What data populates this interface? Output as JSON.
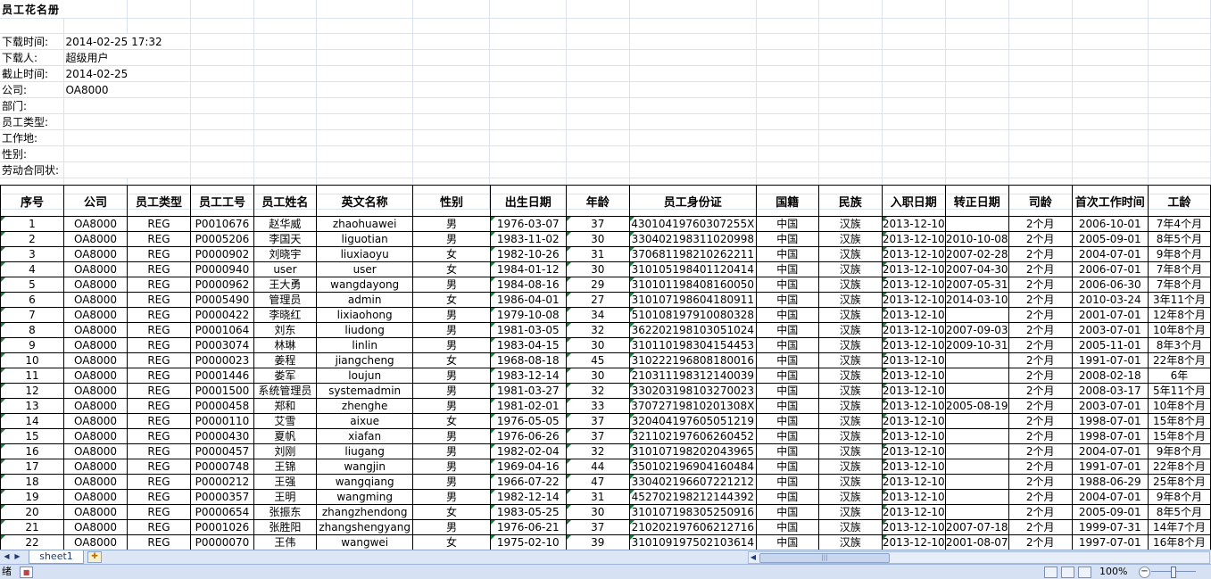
{
  "title": "员工花名册",
  "meta": [
    {
      "label": "下载时间:",
      "value": "2014-02-25 17:32"
    },
    {
      "label": "下载人:",
      "value": "超级用户"
    },
    {
      "label": "截止时间:",
      "value": "2014-02-25"
    },
    {
      "label": "公司:",
      "value": "OA8000"
    },
    {
      "label": "部门:",
      "value": ""
    },
    {
      "label": "员工类型:",
      "value": ""
    },
    {
      "label": "工作地:",
      "value": ""
    },
    {
      "label": "性别:",
      "value": ""
    },
    {
      "label": "劳动合同状:",
      "value": ""
    }
  ],
  "table": {
    "headers": [
      "序号",
      "公司",
      "员工类型",
      "员工工号",
      "员工姓名",
      "英文名称",
      "性别",
      "出生日期",
      "年龄",
      "员工身份证",
      "国籍",
      "民族",
      "入职日期",
      "转正日期",
      "司龄",
      "首次工作时间",
      "工龄"
    ],
    "rows": [
      [
        "1",
        "OA8000",
        "REG",
        "P0010676",
        "赵华威",
        "zhaohuawei",
        "男",
        "1976-03-07",
        "37",
        "43010419760307255X",
        "中国",
        "汉族",
        "2013-12-10",
        "",
        "2个月",
        "2006-10-01",
        "7年4个月"
      ],
      [
        "2",
        "OA8000",
        "REG",
        "P0005206",
        "李国天",
        "liguotian",
        "男",
        "1983-11-02",
        "30",
        "330402198311020998",
        "中国",
        "汉族",
        "2013-12-10",
        "2010-10-08",
        "2个月",
        "2005-09-01",
        "8年5个月"
      ],
      [
        "3",
        "OA8000",
        "REG",
        "P0000902",
        "刘晓宇",
        "liuxiaoyu",
        "女",
        "1982-10-26",
        "31",
        "370681198210262211",
        "中国",
        "汉族",
        "2013-12-10",
        "2007-02-28",
        "2个月",
        "2004-07-01",
        "9年8个月"
      ],
      [
        "4",
        "OA8000",
        "REG",
        "P0000940",
        "user",
        "user",
        "女",
        "1984-01-12",
        "30",
        "310105198401120414",
        "中国",
        "汉族",
        "2013-12-10",
        "2007-04-30",
        "2个月",
        "2006-07-01",
        "7年8个月"
      ],
      [
        "5",
        "OA8000",
        "REG",
        "P0000962",
        "王大勇",
        "wangdayong",
        "男",
        "1984-08-16",
        "29",
        "310101198408160050",
        "中国",
        "汉族",
        "2013-12-10",
        "2007-05-31",
        "2个月",
        "2006-06-30",
        "7年8个月"
      ],
      [
        "6",
        "OA8000",
        "REG",
        "P0005490",
        "管理员",
        "admin",
        "女",
        "1986-04-01",
        "27",
        "310107198604180911",
        "中国",
        "汉族",
        "2013-12-10",
        "2014-03-10",
        "2个月",
        "2010-03-24",
        "3年11个月"
      ],
      [
        "7",
        "OA8000",
        "REG",
        "P0000422",
        "李晓红",
        "lixiaohong",
        "男",
        "1979-10-08",
        "34",
        "510108197910080328",
        "中国",
        "汉族",
        "2013-12-10",
        "",
        "2个月",
        "2001-07-01",
        "12年8个月"
      ],
      [
        "8",
        "OA8000",
        "REG",
        "P0001064",
        "刘东",
        "liudong",
        "男",
        "1981-03-05",
        "32",
        "362202198103051024",
        "中国",
        "汉族",
        "2013-12-10",
        "2007-09-03",
        "2个月",
        "2003-07-01",
        "10年8个月"
      ],
      [
        "9",
        "OA8000",
        "REG",
        "P0003074",
        "林琳",
        "linlin",
        "男",
        "1983-04-15",
        "30",
        "310110198304154453",
        "中国",
        "汉族",
        "2013-12-10",
        "2009-10-31",
        "2个月",
        "2005-11-01",
        "8年3个月"
      ],
      [
        "10",
        "OA8000",
        "REG",
        "P0000023",
        "姜程",
        "jiangcheng",
        "女",
        "1968-08-18",
        "45",
        "310222196808180016",
        "中国",
        "汉族",
        "2013-12-10",
        "",
        "2个月",
        "1991-07-01",
        "22年8个月"
      ],
      [
        "11",
        "OA8000",
        "REG",
        "P0001446",
        "娄军",
        "loujun",
        "男",
        "1983-12-14",
        "30",
        "210311198312140039",
        "中国",
        "汉族",
        "2013-12-10",
        "",
        "2个月",
        "2008-02-18",
        "6年"
      ],
      [
        "12",
        "OA8000",
        "REG",
        "P0001500",
        "系统管理员",
        "systemadmin",
        "男",
        "1981-03-27",
        "32",
        "330203198103270023",
        "中国",
        "汉族",
        "2013-12-10",
        "",
        "2个月",
        "2008-03-17",
        "5年11个月"
      ],
      [
        "13",
        "OA8000",
        "REG",
        "P0000458",
        "郑和",
        "zhenghe",
        "男",
        "1981-02-01",
        "33",
        "37072719810201308X",
        "中国",
        "汉族",
        "2013-12-10",
        "2005-08-19",
        "2个月",
        "2003-07-01",
        "10年8个月"
      ],
      [
        "14",
        "OA8000",
        "REG",
        "P0000110",
        "艾雪",
        "aixue",
        "女",
        "1976-05-05",
        "37",
        "320404197605051219",
        "中国",
        "汉族",
        "2013-12-10",
        "",
        "2个月",
        "1998-07-01",
        "15年8个月"
      ],
      [
        "15",
        "OA8000",
        "REG",
        "P0000430",
        "夏帆",
        "xiafan",
        "男",
        "1976-06-26",
        "37",
        "321102197606260452",
        "中国",
        "汉族",
        "2013-12-10",
        "",
        "2个月",
        "1998-07-01",
        "15年8个月"
      ],
      [
        "16",
        "OA8000",
        "REG",
        "P0000457",
        "刘刚",
        "liugang",
        "男",
        "1982-02-04",
        "32",
        "310107198202043965",
        "中国",
        "汉族",
        "2013-12-10",
        "",
        "2个月",
        "2004-07-01",
        "9年8个月"
      ],
      [
        "17",
        "OA8000",
        "REG",
        "P0000748",
        "王锦",
        "wangjin",
        "男",
        "1969-04-16",
        "44",
        "350102196904160484",
        "中国",
        "汉族",
        "2013-12-10",
        "",
        "2个月",
        "1991-07-01",
        "22年8个月"
      ],
      [
        "18",
        "OA8000",
        "REG",
        "P0000212",
        "王强",
        "wangqiang",
        "男",
        "1966-07-22",
        "47",
        "330402196607221212",
        "中国",
        "汉族",
        "2013-12-10",
        "",
        "2个月",
        "1988-06-29",
        "25年8个月"
      ],
      [
        "19",
        "OA8000",
        "REG",
        "P0000357",
        "王明",
        "wangming",
        "男",
        "1982-12-14",
        "31",
        "452702198212144392",
        "中国",
        "汉族",
        "2013-12-10",
        "",
        "2个月",
        "2004-07-01",
        "9年8个月"
      ],
      [
        "20",
        "OA8000",
        "REG",
        "P0000654",
        "张振东",
        "zhangzhendong",
        "女",
        "1983-05-25",
        "30",
        "310107198305250916",
        "中国",
        "汉族",
        "2013-12-10",
        "",
        "2个月",
        "2005-09-01",
        "8年5个月"
      ],
      [
        "21",
        "OA8000",
        "REG",
        "P0001026",
        "张胜阳",
        "zhangshengyang",
        "男",
        "1976-06-21",
        "37",
        "210202197606212716",
        "中国",
        "汉族",
        "2013-12-10",
        "2007-07-18",
        "2个月",
        "1999-07-31",
        "14年7个月"
      ],
      [
        "22",
        "OA8000",
        "REG",
        "P0000070",
        "王伟",
        "wangwei",
        "女",
        "1975-02-10",
        "39",
        "310109197502103614",
        "中国",
        "汉族",
        "2013-12-10",
        "2001-08-07",
        "2个月",
        "1997-07-01",
        "16年8个月"
      ]
    ]
  },
  "tabs": {
    "sheet_name": "sheet1"
  },
  "nav": {
    "first": "◀",
    "last": "▶"
  },
  "status": {
    "text": "绪",
    "zoom": "100%",
    "zoom_out": "−"
  },
  "icons": {
    "new_sheet": "new-sheet-icon",
    "macro": "macro-record-icon",
    "grip": "scroll-grip-icon"
  }
}
